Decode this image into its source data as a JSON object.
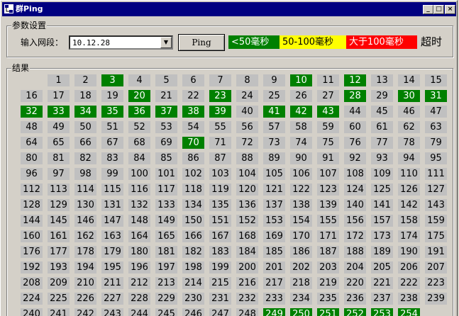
{
  "window": {
    "title": "群Ping",
    "icon": "network-icon",
    "controls": [
      "_",
      "□",
      "×"
    ]
  },
  "params": {
    "group_label": "参数设置",
    "segment_label": "输入网段：",
    "segment_value": "10.12.28",
    "ping_label": "Ping",
    "legend_fast": "<50毫秒",
    "legend_mid": "50-100毫秒",
    "legend_slow": "大于100毫秒",
    "legend_timeout": "超时",
    "colors": {
      "fast": "#008000",
      "mid": "#ffff00",
      "slow": "#ff0000",
      "cell": "#c0c0c0"
    }
  },
  "results": {
    "group_label": "结果",
    "first_host": 1,
    "last_host": 254,
    "green_hosts": [
      3,
      10,
      12,
      20,
      23,
      28,
      30,
      31,
      32,
      33,
      34,
      35,
      36,
      37,
      38,
      39,
      41,
      42,
      43,
      70,
      249,
      250,
      251,
      252,
      253,
      254
    ]
  }
}
